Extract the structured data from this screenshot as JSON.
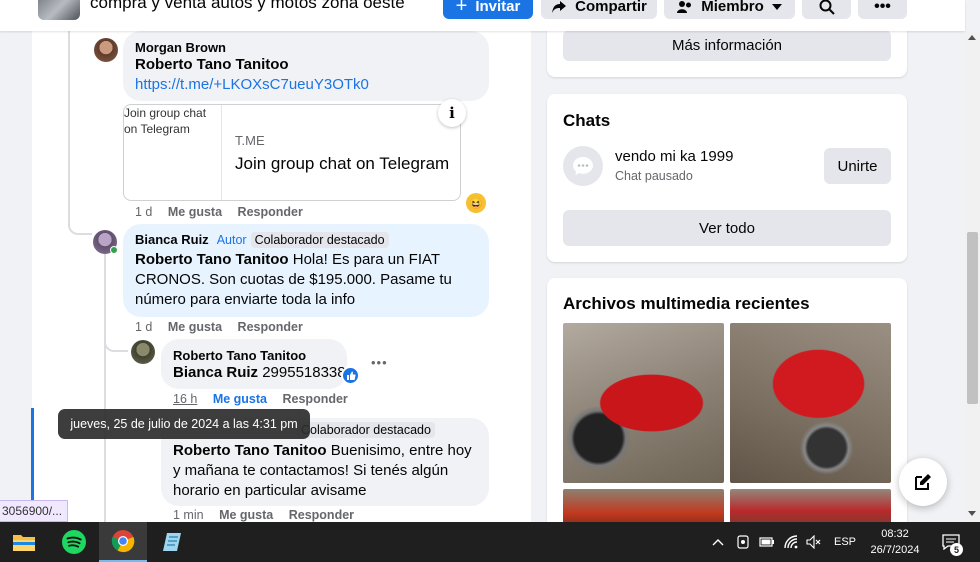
{
  "header": {
    "group_name": "compra y venta autos y motos zona oeste",
    "invite_label": "Invitar",
    "share_label": "Compartir",
    "member_label": "Miembro"
  },
  "comments": [
    {
      "author": "Morgan Brown",
      "mention": "Roberto Tano Tanitoo",
      "link": "https://t.me/+LKOXsC7ueuY3OTk0",
      "card": {
        "image_alt": "Join group chat on Telegram",
        "domain": "T.ME",
        "title": "Join group chat on Telegram"
      },
      "time": "1 d",
      "like": "Me gusta",
      "reply": "Responder"
    },
    {
      "author": "Bianca Ruiz",
      "author_label": "Autor",
      "badge": "Colaborador destacado",
      "mention": "Roberto Tano Tanitoo",
      "text": " Hola! Es para un FIAT CRONOS. Son cuotas de $195.000. Pasame tu número para enviarte toda la info",
      "time": "1 d",
      "like": "Me gusta",
      "reply": "Responder"
    },
    {
      "author": "Roberto Tano Tanitoo",
      "mention": "Bianca Ruiz",
      "text": " 2995518338",
      "time": "16 h",
      "like": "Me gusta",
      "reply": "Responder"
    },
    {
      "badge": "Colaborador destacado",
      "mention": "Roberto Tano Tanitoo",
      "text": " Buenisimo, entre hoy y mañana te contactamos! Si tenés algún horario en particular avisame",
      "time": "1 min",
      "like": "Me gusta",
      "reply": "Responder"
    }
  ],
  "tooltip": "jueves, 25 de julio de 2024 a las 4:31 pm",
  "url_preview": "3056900/...",
  "sidebar": {
    "more_info_label": "Más información",
    "chats_title": "Chats",
    "chat_name": "vendo mi ka 1999",
    "chat_status": "Chat pausado",
    "join_label": "Unirte",
    "see_all_label": "Ver todo",
    "media_title": "Archivos multimedia recientes"
  },
  "taskbar": {
    "language": "ESP",
    "time": "08:32",
    "date": "26/7/2024",
    "notification_count": "5"
  },
  "colors": {
    "accent": "#1b74e4",
    "author_bubble": "#e7f3ff",
    "bubble": "#f0f2f5"
  }
}
